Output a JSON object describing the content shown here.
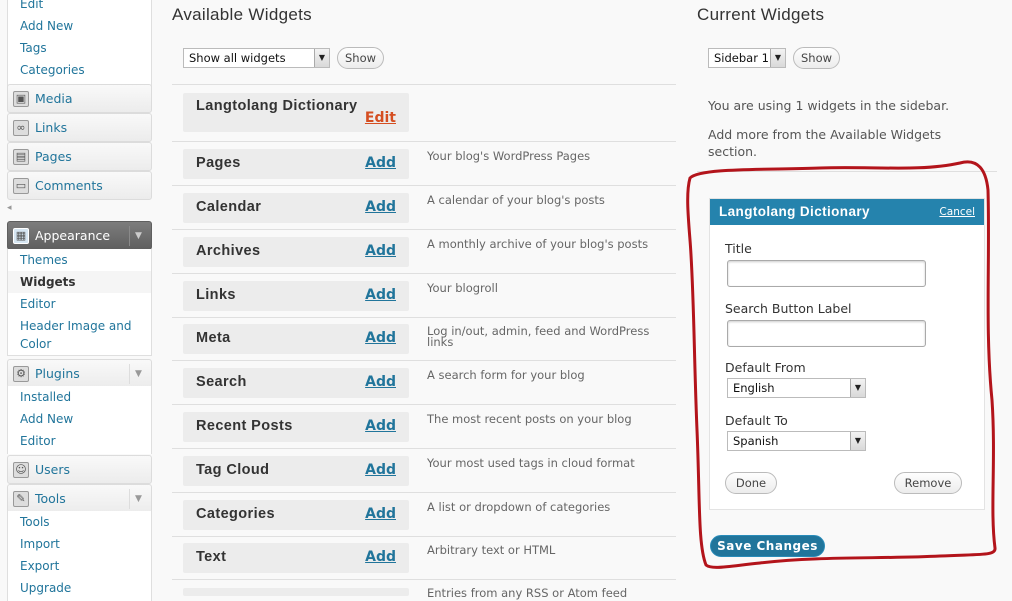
{
  "sidebar": {
    "posts_sub": [
      "Edit",
      "Add New",
      "Tags",
      "Categories"
    ],
    "media": {
      "label": "Media",
      "icon": "media-icon"
    },
    "links": {
      "label": "Links",
      "icon": "links-icon"
    },
    "pages": {
      "label": "Pages",
      "icon": "pages-icon"
    },
    "comments": {
      "label": "Comments",
      "icon": "comments-icon"
    },
    "appearance": {
      "label": "Appearance",
      "icon": "appearance-icon"
    },
    "appearance_sub": [
      "Themes",
      "Widgets",
      "Editor",
      "Header Image and",
      "Color"
    ],
    "plugins": {
      "label": "Plugins",
      "icon": "plugins-icon"
    },
    "plugins_sub": [
      "Installed",
      "Add New",
      "Editor"
    ],
    "users": {
      "label": "Users",
      "icon": "users-icon"
    },
    "tools": {
      "label": "Tools",
      "icon": "tools-icon"
    },
    "tools_sub": [
      "Tools",
      "Import",
      "Export",
      "Upgrade"
    ]
  },
  "available": {
    "heading": "Available Widgets",
    "filter_value": "Show all widgets",
    "show_label": "Show",
    "widgets": [
      {
        "title": "Langtolang Dictionary",
        "action": "Edit",
        "desc": ""
      },
      {
        "title": "Pages",
        "action": "Add",
        "desc": "Your blog's WordPress Pages"
      },
      {
        "title": "Calendar",
        "action": "Add",
        "desc": "A calendar of your blog's posts"
      },
      {
        "title": "Archives",
        "action": "Add",
        "desc": "A monthly archive of your blog's posts"
      },
      {
        "title": "Links",
        "action": "Add",
        "desc": "Your blogroll"
      },
      {
        "title": "Meta",
        "action": "Add",
        "desc": "Log in/out, admin, feed and WordPress links"
      },
      {
        "title": "Search",
        "action": "Add",
        "desc": "A search form for your blog"
      },
      {
        "title": "Recent Posts",
        "action": "Add",
        "desc": "The most recent posts on your blog"
      },
      {
        "title": "Tag Cloud",
        "action": "Add",
        "desc": "Your most used tags in cloud format"
      },
      {
        "title": "Categories",
        "action": "Add",
        "desc": "A list or dropdown of categories"
      },
      {
        "title": "Text",
        "action": "Add",
        "desc": "Arbitrary text or HTML"
      }
    ],
    "partial_desc": "Entries from any RSS or Atom feed"
  },
  "current": {
    "heading": "Current Widgets",
    "sidebar_select": "Sidebar 1",
    "show_label": "Show",
    "info1": "You are using 1 widgets in the sidebar.",
    "info2a": "Add more from the Available Widgets",
    "info2b": "section.",
    "panel": {
      "title": "Langtolang Dictionary",
      "cancel": "Cancel",
      "title_label": "Title",
      "title_value": "",
      "button_label_label": "Search Button Label",
      "button_label_value": "",
      "from_label": "Default From",
      "from_value": "English",
      "to_label": "Default To",
      "to_value": "Spanish",
      "done": "Done",
      "remove": "Remove"
    },
    "save": "Save Changes"
  },
  "colors": {
    "accent": "#21759b",
    "panel_header": "#2583ad",
    "edit_link": "#d54e21",
    "annotation": "#b3141b"
  }
}
